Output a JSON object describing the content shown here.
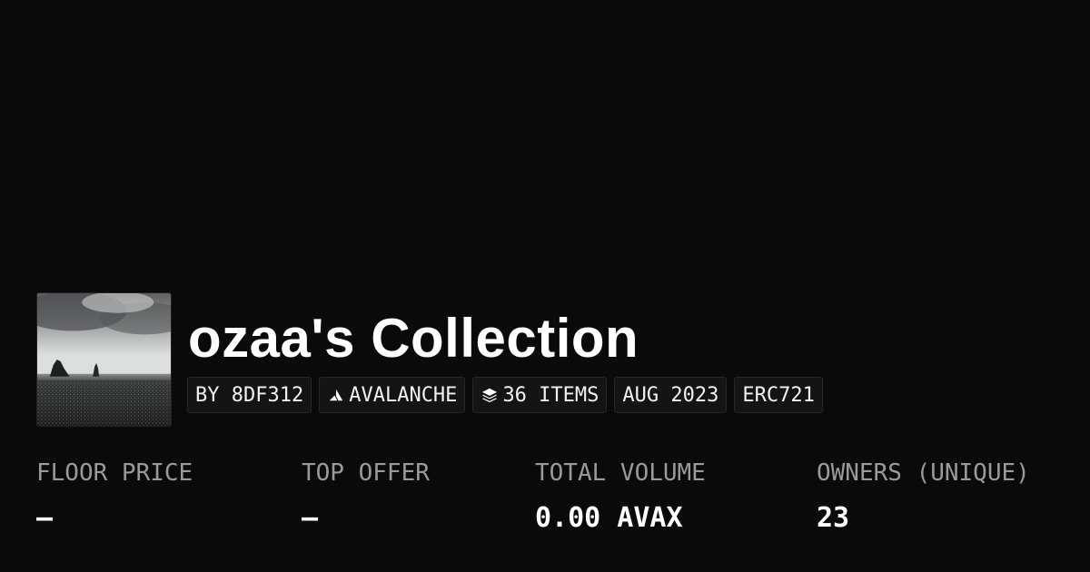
{
  "collection": {
    "title": "ozaa's Collection",
    "thumbnail_alt": "black sand beach with sea stacks under cloudy sky"
  },
  "chips": {
    "creator": "BY 8DF312",
    "chain": "AVALANCHE",
    "items": "36 ITEMS",
    "date": "AUG 2023",
    "standard": "ERC721"
  },
  "icons": {
    "chain_icon": "avalanche-logo-icon",
    "items_icon": "layers-icon"
  },
  "stats": {
    "floor_price": {
      "label": "FLOOR PRICE",
      "value": "–"
    },
    "top_offer": {
      "label": "TOP OFFER",
      "value": "–"
    },
    "total_volume": {
      "label": "TOTAL VOLUME",
      "value": "0.00 AVAX"
    },
    "owners": {
      "label": "OWNERS (UNIQUE)",
      "value": "23"
    }
  },
  "colors": {
    "background": "#0a0a0a",
    "chip_background": "#141414",
    "label_gray": "#9a9a9a",
    "text": "#ffffff"
  }
}
